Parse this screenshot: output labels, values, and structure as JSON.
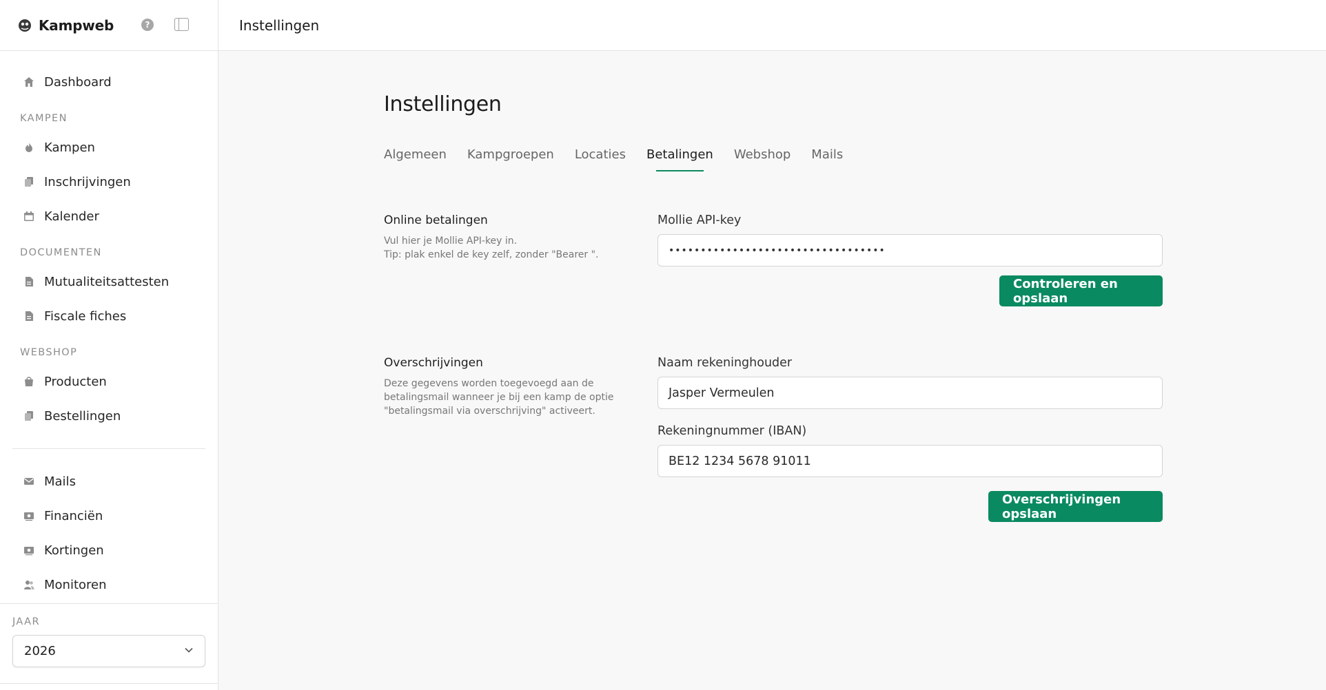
{
  "sidebar": {
    "brand": "Kampweb",
    "items_top": [
      {
        "label": "Dashboard",
        "icon": "home-icon"
      }
    ],
    "sections": [
      {
        "label": "KAMPEN",
        "items": [
          {
            "label": "Kampen",
            "icon": "fire-icon"
          },
          {
            "label": "Inschrijvingen",
            "icon": "clipboard-icon"
          },
          {
            "label": "Kalender",
            "icon": "calendar-icon"
          }
        ]
      },
      {
        "label": "DOCUMENTEN",
        "items": [
          {
            "label": "Mutualiteitsattesten",
            "icon": "document-icon"
          },
          {
            "label": "Fiscale fiches",
            "icon": "document-icon"
          }
        ]
      },
      {
        "label": "WEBSHOP",
        "items": [
          {
            "label": "Producten",
            "icon": "shopping-bag-icon"
          },
          {
            "label": "Bestellingen",
            "icon": "clipboard-icon"
          }
        ]
      }
    ],
    "items_bottom": [
      {
        "label": "Mails",
        "icon": "mail-icon"
      },
      {
        "label": "Financiën",
        "icon": "banknote-icon"
      },
      {
        "label": "Kortingen",
        "icon": "banknote-icon"
      },
      {
        "label": "Monitoren",
        "icon": "users-icon"
      }
    ],
    "year_label": "JAAR",
    "year_value": "2026"
  },
  "topbar": {
    "title": "Instellingen"
  },
  "page": {
    "title": "Instellingen",
    "tabs": [
      "Algemeen",
      "Kampgroepen",
      "Locaties",
      "Betalingen",
      "Webshop",
      "Mails"
    ],
    "active_tab": "Betalingen"
  },
  "online": {
    "title": "Online betalingen",
    "desc1": "Vul hier je Mollie API-key in.",
    "desc2": "Tip: plak enkel de key zelf, zonder \"Bearer \".",
    "field_label": "Mollie API-key",
    "field_value": "••••••••••••••••••••••••••••••••••",
    "button": "Controleren en opslaan"
  },
  "transfer": {
    "title": "Overschrijvingen",
    "desc": "Deze gegevens worden toegevoegd aan de betalingsmail wanneer je bij een kamp de optie \"betalingsmail via overschrijving\" activeert.",
    "name_label": "Naam rekeninghouder",
    "name_value": "Jasper Vermeulen",
    "iban_label": "Rekeningnummer (IBAN)",
    "iban_value": "BE12 1234 5678 91011",
    "button": "Overschrijvingen opslaan"
  },
  "colors": {
    "accent": "#0a8a60",
    "background": "#f8f8f8"
  }
}
